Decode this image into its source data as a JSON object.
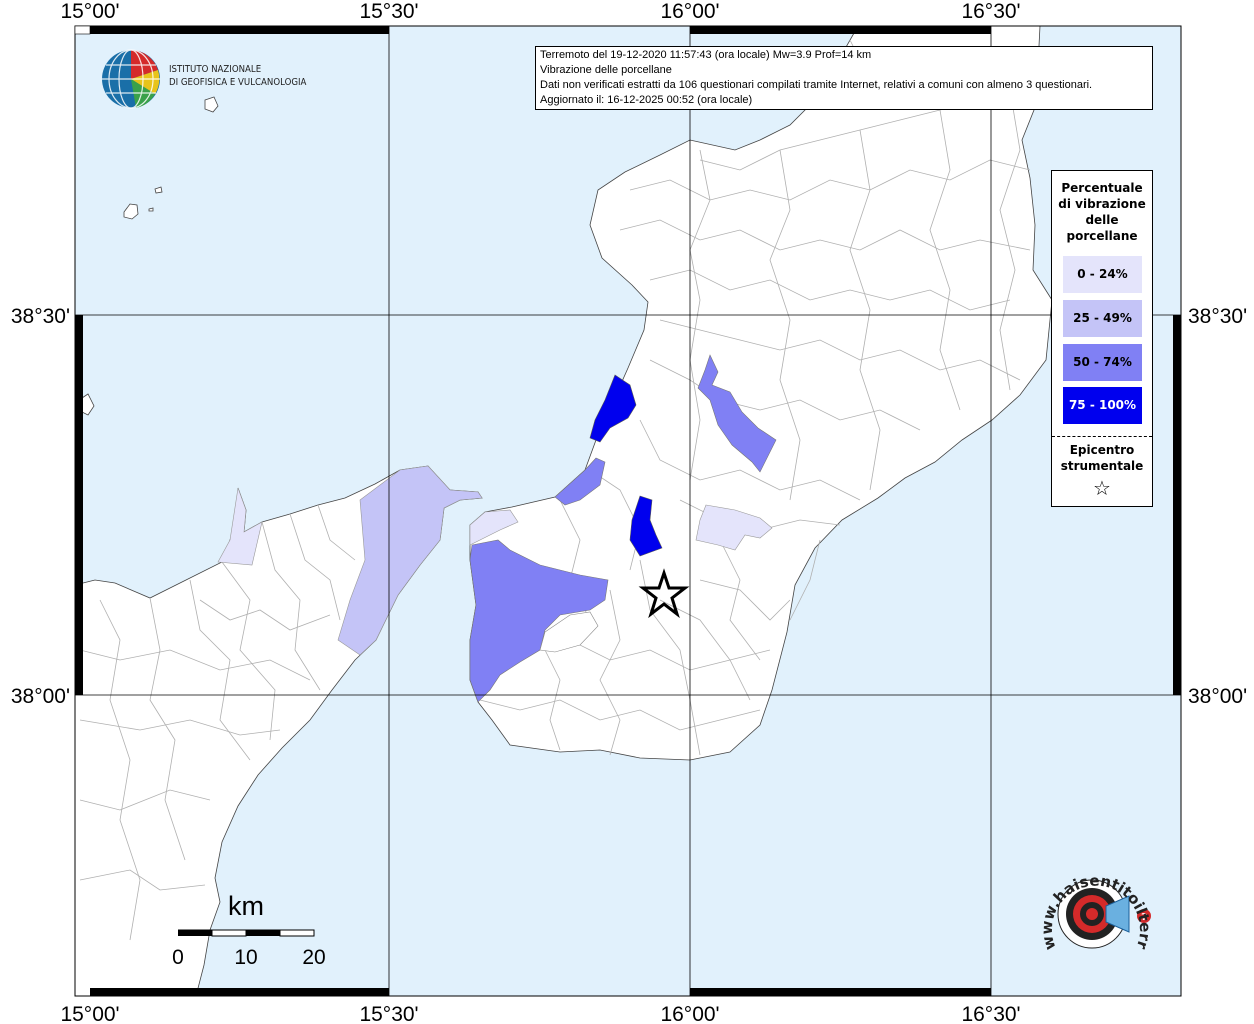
{
  "graticule": {
    "lon_labels": [
      "15°00'",
      "15°30'",
      "16°00'",
      "16°30'"
    ],
    "lat_labels": [
      "38°30'",
      "38°00'"
    ]
  },
  "info_box": {
    "line1": "Terremoto del 19-12-2020 11:57:43 (ora locale) Mw=3.9 Prof=14 km",
    "line2": "Vibrazione delle porcellane",
    "line3": "Dati non verificati estratti da 106 questionari compilati tramite Internet, relativi a comuni con almeno 3 questionari.",
    "line4": "Aggiornato il: 16-12-2025 00:52 (ora locale)"
  },
  "legend": {
    "title_line1": "Percentuale",
    "title_line2": "di vibrazione",
    "title_line3": "delle",
    "title_line4": "porcellane",
    "classes": [
      {
        "label": "0 - 24%",
        "color": "#e4e4fb"
      },
      {
        "label": "25 - 49%",
        "color": "#c4c4f7"
      },
      {
        "label": "50 - 74%",
        "color": "#8080f4"
      },
      {
        "label": "75 - 100%",
        "color": "#0000ee"
      }
    ],
    "epicenter_line1": "Epicentro",
    "epicenter_line2": "strumentale",
    "epicenter_symbol": "☆"
  },
  "logo_ingv": {
    "line1": "ISTITUTO NAZIONALE",
    "line2": "DI GEOFISICA E VULCANOLOGIA"
  },
  "scale_bar": {
    "unit": "km",
    "ticks": [
      "0",
      "10",
      "20"
    ]
  },
  "logo_hsit": {
    "text": "www.haisentitoilterremoto.it"
  },
  "colors": {
    "sea": "#e1f1fc",
    "land": "#ffffff",
    "grid": "#000000",
    "borders": "#b0b0b0"
  }
}
